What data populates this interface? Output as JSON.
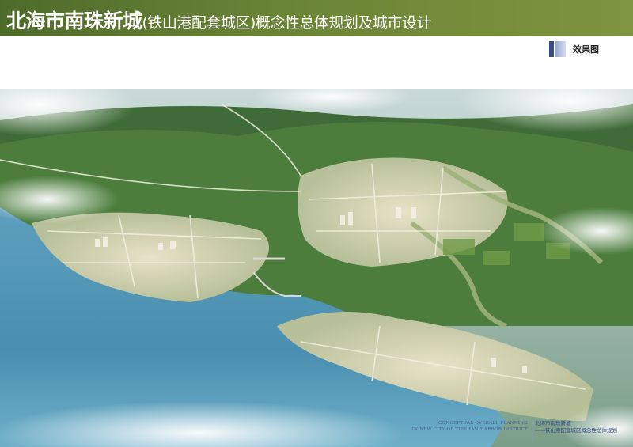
{
  "header": {
    "title_main": "北海市南珠新城",
    "title_sub": "(铁山港配套城区)概念性总体规划及城市设计"
  },
  "tag": {
    "label": "效果图"
  },
  "colors": {
    "header_green": "#5a7630",
    "tag_blue": "#3a4d85",
    "water": "#4f95b6"
  },
  "image": {
    "description_icon": "aerial-rendering-image"
  },
  "caption": {
    "english_line1": "CONCEPTUAL OVERALL PLANNING",
    "english_line2": "IN NEW CITY OF TIESHAN HARBOR DISTRICT",
    "chinese_line1": "北海市南珠新城",
    "chinese_line2": "——铁山港配套城区概念性总体规划"
  }
}
